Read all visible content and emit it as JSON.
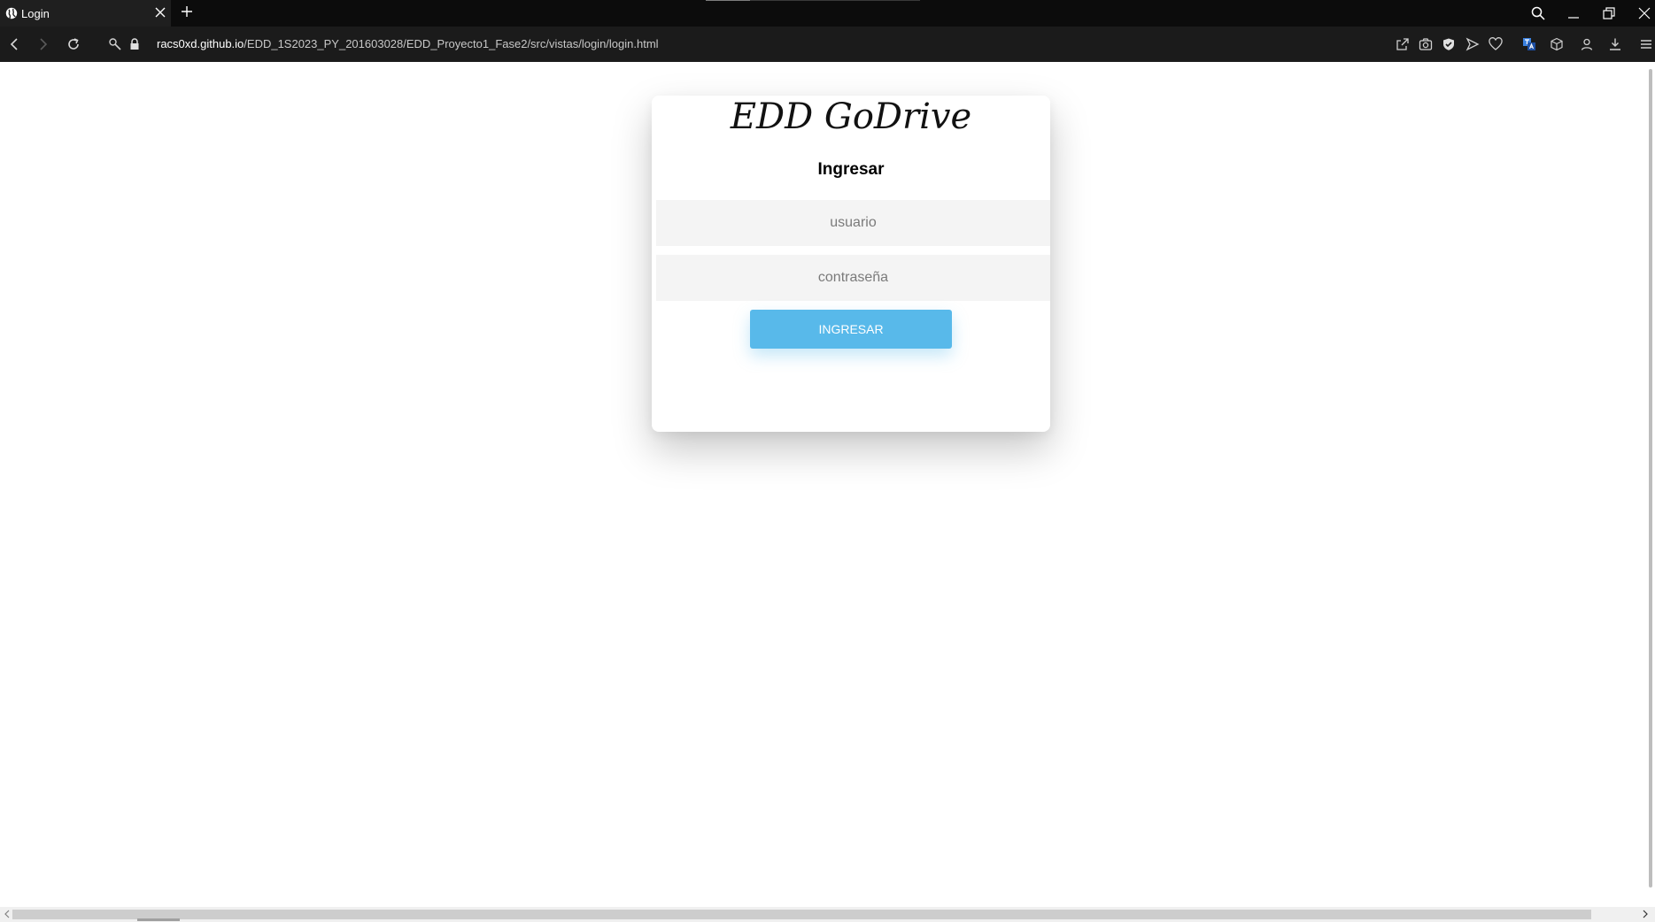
{
  "browser": {
    "tab": {
      "title": "Login"
    },
    "url": {
      "host": "racs0xd.github.io",
      "path": "/EDD_1S2023_PY_201603028/EDD_Proyecto1_Fase2/src/vistas/login/login.html"
    }
  },
  "login": {
    "logo_text": "EDD GoDrive",
    "title": "Ingresar",
    "username_placeholder": "usuario",
    "password_placeholder": "contraseña",
    "submit_label": "INGRESAR"
  },
  "colors": {
    "accent": "#58b9ea",
    "field_bg": "#f4f4f4",
    "chrome_bg": "#1b1b1b"
  }
}
